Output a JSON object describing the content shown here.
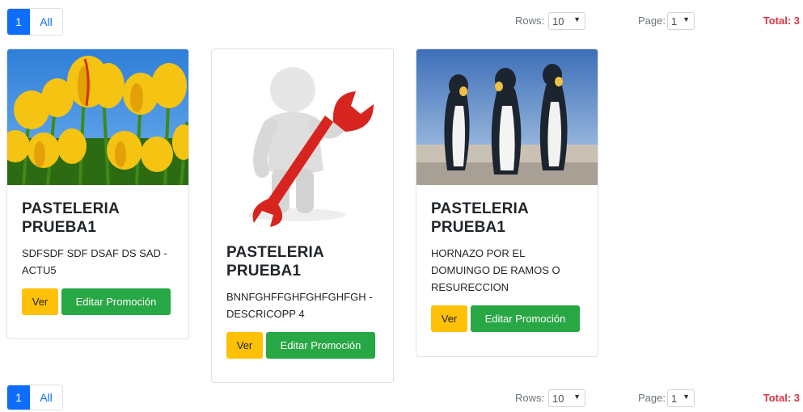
{
  "pagination_top": {
    "active_page": "1",
    "all_label": "All",
    "rows_label": "Rows:",
    "rows_value": "10",
    "page_label": "Page:",
    "page_value": "1",
    "total_label": "Total: 3"
  },
  "pagination_bottom": {
    "active_page": "1",
    "all_label": "All",
    "rows_label": "Rows:",
    "rows_value": "10",
    "page_label": "Page:",
    "page_value": "1",
    "total_label": "Total: 3"
  },
  "cards": [
    {
      "title": "PASTELERIA PRUEBA1",
      "description": "SDFSDF SDF DSAF DS SAD - ACTU5",
      "image": "yellow-tulips-image",
      "view_label": "Ver",
      "edit_label": "Editar Promoción"
    },
    {
      "title": "PASTELERIA PRUEBA1",
      "description": "BNNFGHFFGHFGHFGHFGH - DESCRICOPP 4",
      "image": "wrench-figure-image",
      "view_label": "Ver",
      "edit_label": "Editar Promoción"
    },
    {
      "title": "PASTELERIA PRUEBA1",
      "description": "HORNAZO POR EL DOMUINGO DE RAMOS O RESURECCION",
      "image": "penguins-image",
      "view_label": "Ver",
      "edit_label": "Editar Promoción"
    }
  ],
  "colors": {
    "primary": "#0d6efd",
    "warning": "#ffc107",
    "success": "#28a745",
    "danger": "#dc3545"
  }
}
